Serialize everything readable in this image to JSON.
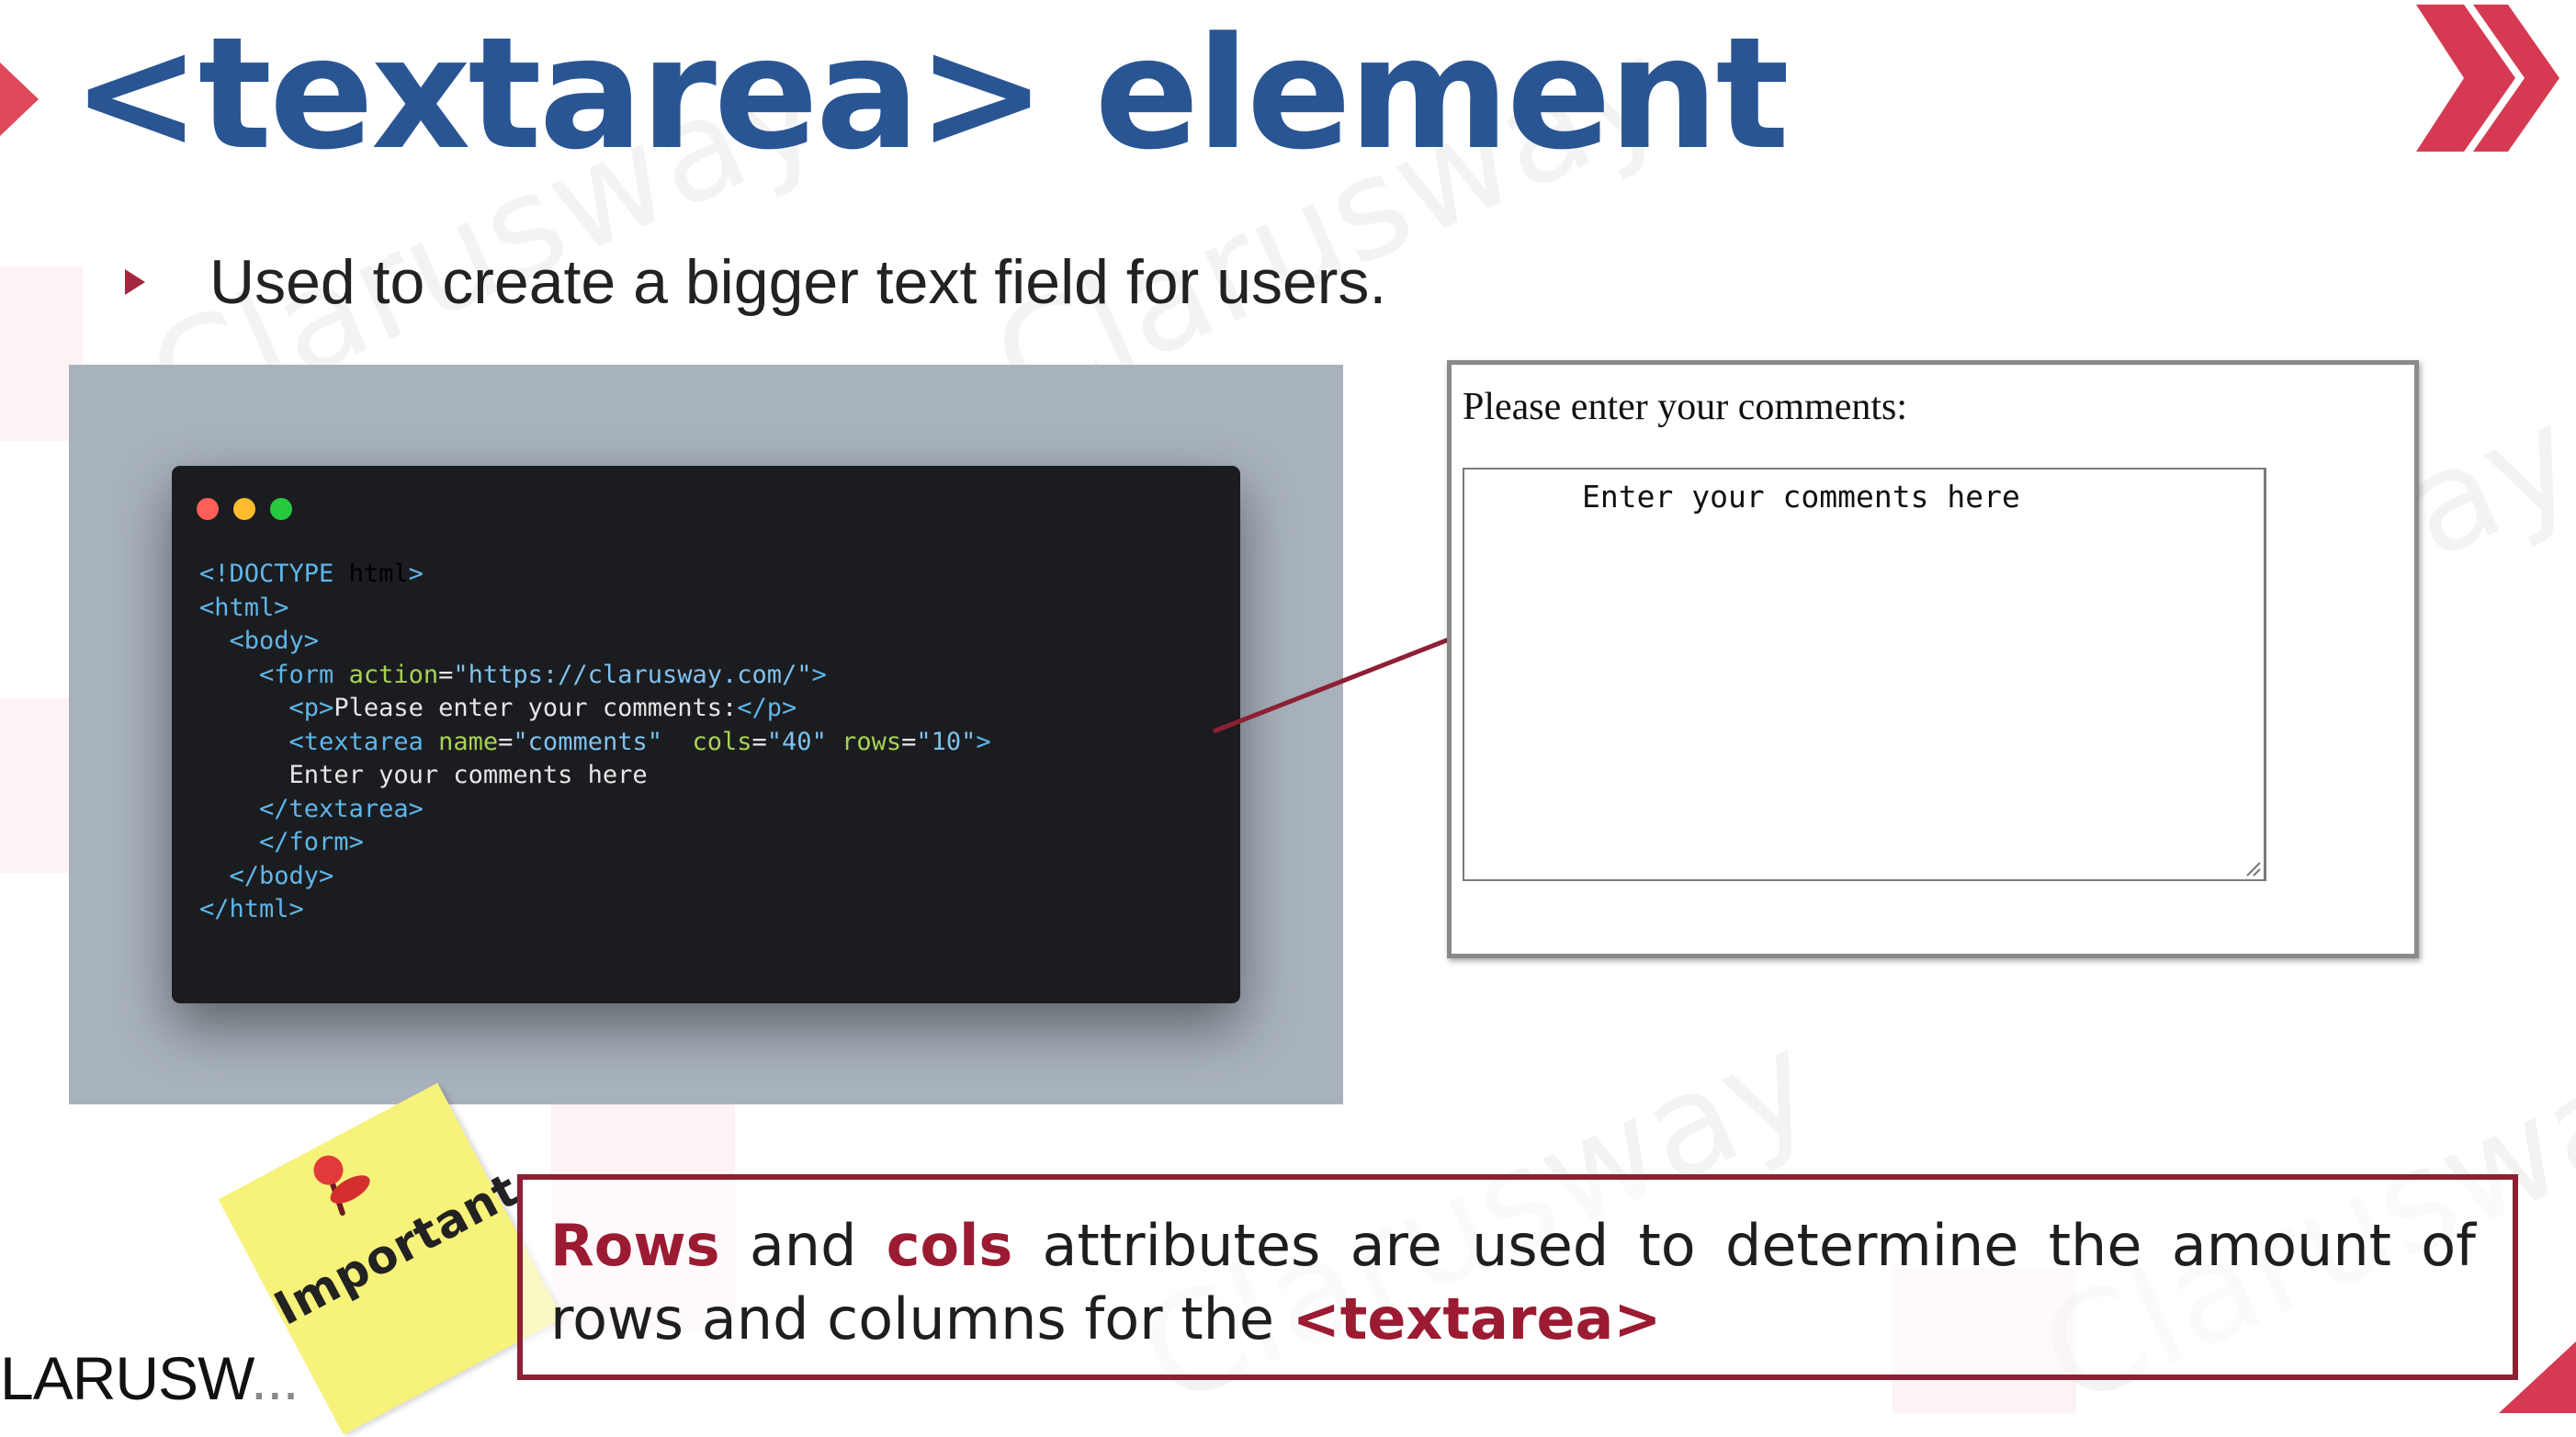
{
  "slide": {
    "title": "<textarea> element",
    "bullet": "Used to create a bigger text field for users.",
    "watermark": "Clarusway",
    "colors": {
      "title": "#2a5593",
      "accent": "#9b1b32",
      "code_bg": "#1b1c1f",
      "panel_bg": "#a8b2bd",
      "sticky": "#f7f27a"
    }
  },
  "code_window": {
    "dots": [
      "#ff5f56",
      "#ffbd2e",
      "#27c93f"
    ],
    "lines": [
      "<!DOCTYPE html>",
      "<html>",
      "  <body>",
      "    <form action=\"https://clarusway.com/\">",
      "      <p>Please enter your comments:</p>",
      "      <textarea name=\"comments\"  cols=\"40\" rows=\"10\">",
      "      Enter your comments here",
      "    </textarea>",
      "    </form>",
      "  </body>",
      "</html>"
    ]
  },
  "preview": {
    "label": "Please enter your comments:",
    "textarea_value": "Enter your comments here"
  },
  "note": {
    "sticky": "Important",
    "parts": [
      {
        "text": "Rows",
        "bold": true
      },
      {
        "text": " and ",
        "bold": false
      },
      {
        "text": "cols",
        "bold": true
      },
      {
        "text": " attributes are used to determine the amount of rows and columns for the ",
        "bold": false
      },
      {
        "text": "<textarea>",
        "bold": true
      }
    ]
  },
  "footer": {
    "logo_visible": "LARUSW",
    "logo_fade": "..."
  }
}
